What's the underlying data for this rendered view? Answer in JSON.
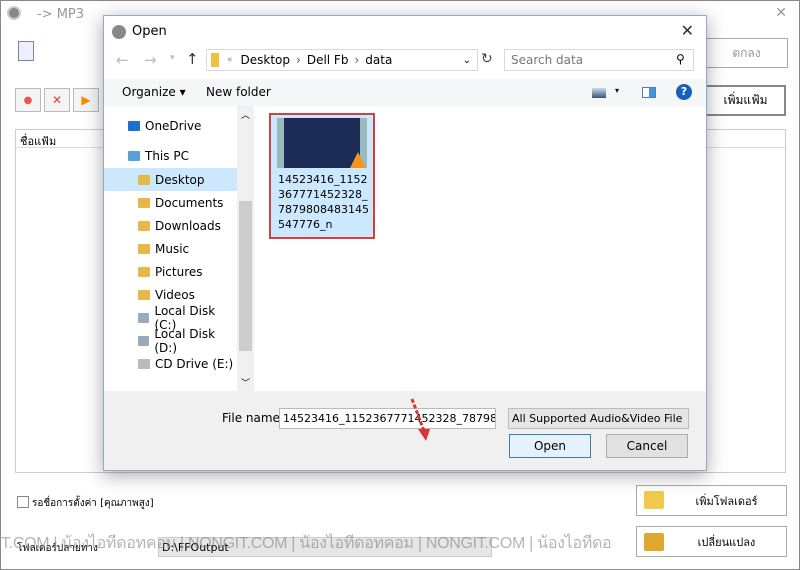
{
  "app": {
    "title": "-> MP3",
    "ok_label": "ตกลง",
    "add_file_label": "เพิ่มแฟ้ม",
    "list_header": "ชื่อแฟ้ม",
    "checkbox_label": "รอชื่อการตั้งค่า [คุณภาพสูง]",
    "add_folder_label": "เพิ่มโฟลเดอร์",
    "output_folder_label": "โฟลเดอร์ปลายทาง",
    "output_folder_value": "D:\\FFOutput",
    "change_label": "เปลี่ยนแปลง",
    "watermark": "T.COM | น้องไอทีดอทคอม | NONGIT.COM | น้องไอทีดอทคอม | NONGIT.COM | น้องไอทีดอ"
  },
  "dialog": {
    "title": "Open",
    "breadcrumb": [
      "Desktop",
      "Dell Fb",
      "data"
    ],
    "search_placeholder": "Search data",
    "toolbar": {
      "organize": "Organize",
      "new_folder": "New folder"
    },
    "nav": [
      {
        "label": "OneDrive",
        "icon": "cloud-icon"
      },
      {
        "label": "This PC",
        "icon": "computer-icon"
      },
      {
        "label": "Desktop",
        "icon": "folder-icon",
        "selected": true
      },
      {
        "label": "Documents",
        "icon": "folder-icon"
      },
      {
        "label": "Downloads",
        "icon": "folder-icon"
      },
      {
        "label": "Music",
        "icon": "folder-icon"
      },
      {
        "label": "Pictures",
        "icon": "folder-icon"
      },
      {
        "label": "Videos",
        "icon": "folder-icon"
      },
      {
        "label": "Local Disk (C:)",
        "icon": "drive-icon"
      },
      {
        "label": "Local Disk (D:)",
        "icon": "drive-icon"
      },
      {
        "label": "CD Drive (E:)",
        "icon": "cd-icon"
      }
    ],
    "file": {
      "name": "14523416_1152367771452328_7879808483145547776_n"
    },
    "file_name_label": "File name:",
    "file_name_value": "14523416_1152367771452328_78798(",
    "filter_value": "All Supported Audio&Video File",
    "open_label": "Open",
    "cancel_label": "Cancel"
  }
}
